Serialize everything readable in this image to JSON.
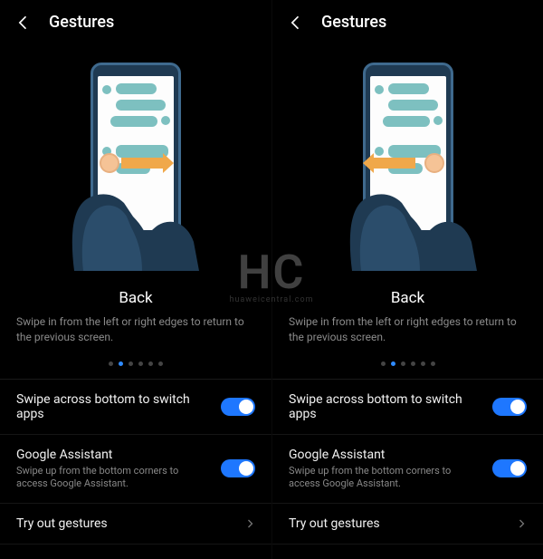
{
  "header": {
    "title": "Gestures"
  },
  "gesture": {
    "title": "Back",
    "description": "Swipe in from the left or right edges to return to the previous screen."
  },
  "pager": {
    "count": 6,
    "active_index": 1
  },
  "settings": {
    "swipe_switch": {
      "label": "Swipe across bottom to switch apps",
      "enabled": true
    },
    "google_assistant": {
      "label": "Google Assistant",
      "sublabel": "Swipe up from the bottom corners to access Google Assistant.",
      "enabled": true
    },
    "try_out": {
      "label": "Try out gestures"
    }
  },
  "watermark": {
    "text": "HC",
    "sub": "huaweicentral.com"
  },
  "colors": {
    "accent": "#1e77ff"
  }
}
